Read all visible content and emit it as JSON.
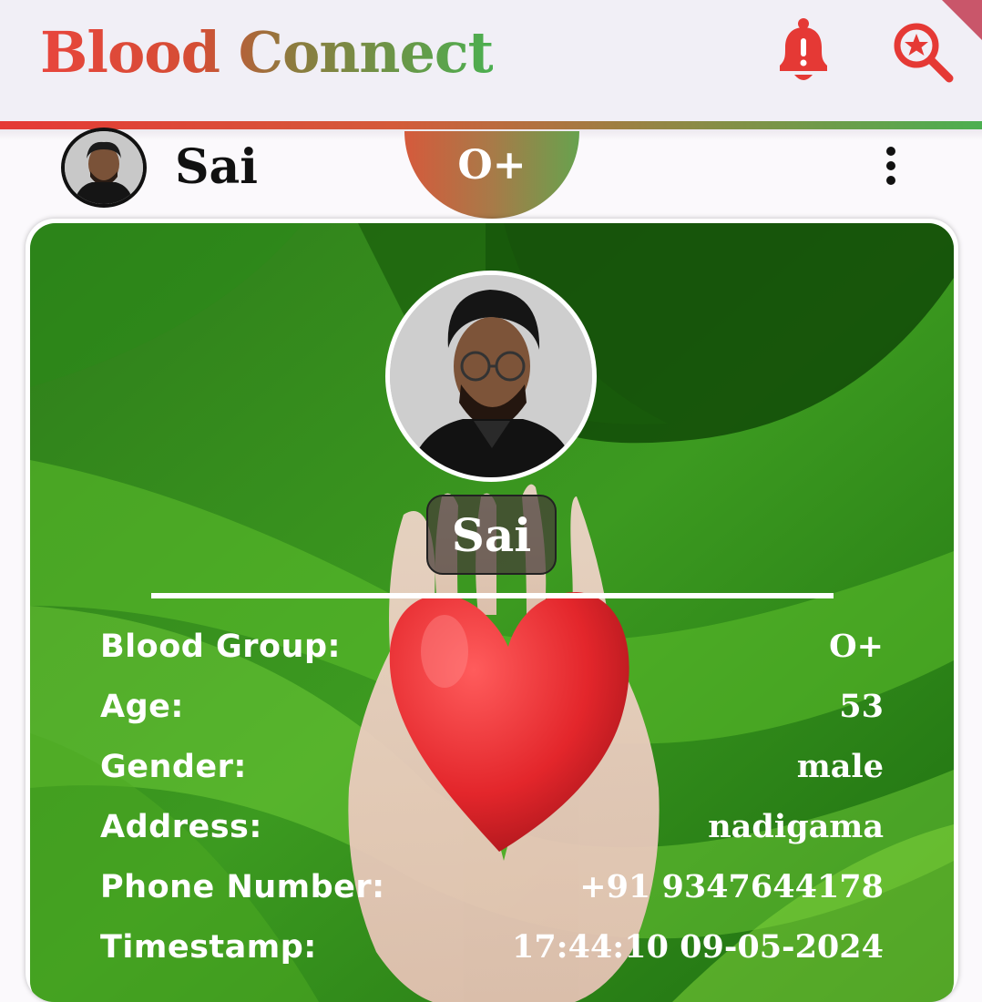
{
  "app": {
    "title": "Blood Connect",
    "colors": {
      "red": "#e53935",
      "green": "#4caf50",
      "card_green": "#3a9a1e"
    }
  },
  "header": {
    "notification_icon": "bell-alert-icon",
    "search_icon": "search-star-icon"
  },
  "post": {
    "poster_name": "Sai",
    "blood_group_badge": "O+",
    "menu_icon": "more-vertical-icon"
  },
  "card": {
    "name": "Sai",
    "details": [
      {
        "label": "Blood Group:",
        "value": "O+"
      },
      {
        "label": "Age:",
        "value": "53"
      },
      {
        "label": "Gender:",
        "value": "male"
      },
      {
        "label": "Address:",
        "value": "nadigama"
      },
      {
        "label": "Phone Number:",
        "value": "+91 9347644178"
      },
      {
        "label": "Timestamp:",
        "value": "17:44:10 09-05-2024"
      }
    ]
  }
}
